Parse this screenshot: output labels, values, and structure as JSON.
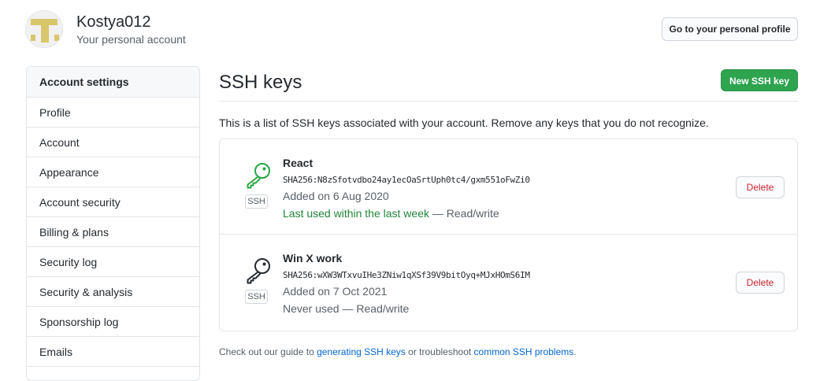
{
  "user": {
    "name": "Kostya012",
    "subtitle": "Your personal account"
  },
  "header": {
    "profile_button": "Go to your personal profile"
  },
  "sidebar": {
    "heading": "Account settings",
    "items": [
      {
        "label": "Profile"
      },
      {
        "label": "Account"
      },
      {
        "label": "Appearance"
      },
      {
        "label": "Account security"
      },
      {
        "label": "Billing & plans"
      },
      {
        "label": "Security log"
      },
      {
        "label": "Security & analysis"
      },
      {
        "label": "Sponsorship log"
      },
      {
        "label": "Emails"
      }
    ]
  },
  "main": {
    "title": "SSH keys",
    "new_button": "New SSH key",
    "intro": "This is a list of SSH keys associated with your account. Remove any keys that you do not recognize.",
    "keys": [
      {
        "title": "React",
        "badge": "SSH",
        "fingerprint": "SHA256:N8zSfotvdbo24ay1ecOaSrtUph0tc4/gxm551oFwZi0",
        "added": "Added on 6 Aug 2020",
        "last_used": "Last used within the last week",
        "access": " — Read/write",
        "delete_label": "Delete",
        "icon": "key-icon",
        "icon_color": "#28a745"
      },
      {
        "title": "Win X work",
        "badge": "SSH",
        "fingerprint": "SHA256:wXW3WTxvuIHe3ZNiw1qXSf39V9bitOyq+MJxHOmS6IM",
        "added": "Added on 7 Oct 2021",
        "last_used": "Never used",
        "access": " — Read/write",
        "delete_label": "Delete",
        "icon": "key-icon",
        "icon_color": "#24292e"
      }
    ],
    "footer": {
      "prefix": "Check out our guide to ",
      "link1": "generating SSH keys",
      "middle": " or troubleshoot ",
      "link2": "common SSH problems",
      "suffix": "."
    }
  },
  "colors": {
    "primary_button": "#2ea44f",
    "danger": "#cb2431",
    "link": "#0366d6",
    "success": "#22863a"
  }
}
